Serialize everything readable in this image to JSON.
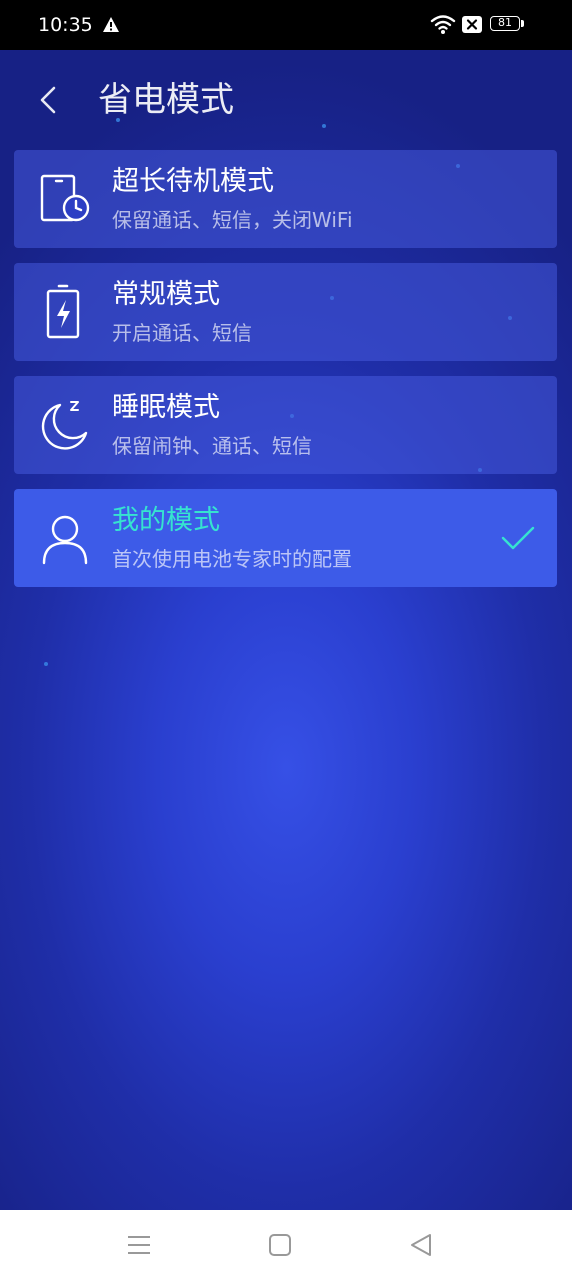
{
  "status_bar": {
    "time": "10:35",
    "battery_level": "81",
    "icons": [
      "warning-icon",
      "wifi-icon",
      "sim-off-icon",
      "battery-icon"
    ]
  },
  "header": {
    "back_icon": "chevron-left-icon",
    "title": "省电模式"
  },
  "modes": [
    {
      "icon": "phone-clock-icon",
      "title": "超长待机模式",
      "description": "保留通话、短信，关闭WiFi",
      "selected": false
    },
    {
      "icon": "battery-charge-icon",
      "title": "常规模式",
      "description": "开启通话、短信",
      "selected": false
    },
    {
      "icon": "moon-sleep-icon",
      "title": "睡眠模式",
      "description": "保留闹钟、通话、短信",
      "selected": false
    },
    {
      "icon": "person-icon",
      "title": "我的模式",
      "description": "首次使用电池专家时的配置",
      "selected": true
    }
  ],
  "colors": {
    "accent": "#36e3d0",
    "selected_card": "#3d5be8",
    "background": "#2a3fcf"
  },
  "nav_bar": {
    "icons": [
      "menu-icon",
      "home-icon",
      "back-triangle-icon"
    ]
  }
}
